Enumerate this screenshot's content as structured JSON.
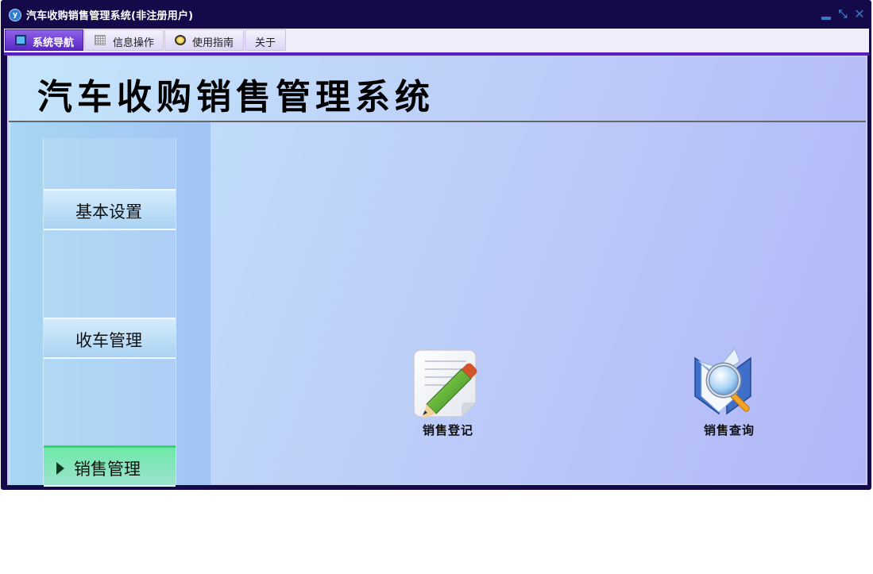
{
  "window": {
    "title": "汽车收购销售管理系统(非注册用户)",
    "controls": {
      "minimize": "▁",
      "restore": "⤡",
      "close": "✕"
    }
  },
  "menu": {
    "tabs": [
      {
        "label": "系统导航",
        "icon": "monitor-icon",
        "active": true
      },
      {
        "label": "信息操作",
        "icon": "grid-icon",
        "active": false
      },
      {
        "label": "使用指南",
        "icon": "compass-icon",
        "active": false
      },
      {
        "label": "关于",
        "icon": "",
        "active": false
      }
    ]
  },
  "header": {
    "title": "汽车收购销售管理系统"
  },
  "sidebar": {
    "items": [
      {
        "label": "基本设置",
        "active": false
      },
      {
        "label": "收车管理",
        "active": false
      },
      {
        "label": "销售管理",
        "active": true
      }
    ]
  },
  "functions": [
    {
      "label": "销售登记",
      "icon": "pencil-notepad-icon"
    },
    {
      "label": "销售查询",
      "icon": "magnifier-book-icon"
    }
  ],
  "colors": {
    "titlebar": "#140a4a",
    "active_tab": "#6a37d8",
    "accent_bar": "#5a1fc3",
    "active_side_item": "#6fe8a7"
  }
}
